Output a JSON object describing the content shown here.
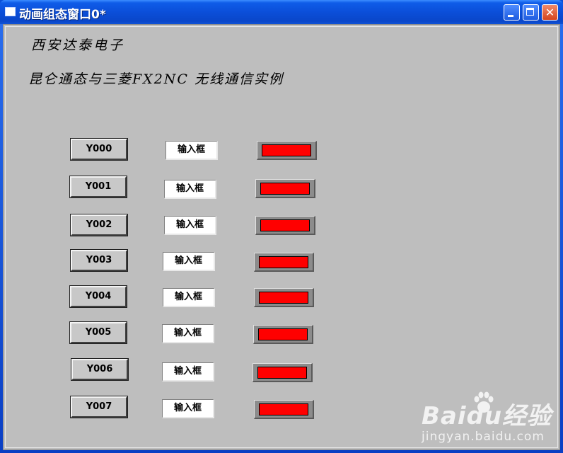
{
  "window": {
    "title": "动画组态窗口0*"
  },
  "labels": {
    "company": "西安达泰电子",
    "description": "昆仑通态与三菱FX2NC 无线通信实例"
  },
  "rows": [
    {
      "button": "Y000",
      "input": "输入框",
      "lamp_color": "#ff0000"
    },
    {
      "button": "Y001",
      "input": "输入框",
      "lamp_color": "#ff0000"
    },
    {
      "button": "Y002",
      "input": "输入框",
      "lamp_color": "#ff0000"
    },
    {
      "button": "Y003",
      "input": "输入框",
      "lamp_color": "#ff0000"
    },
    {
      "button": "Y004",
      "input": "输入框",
      "lamp_color": "#ff0000"
    },
    {
      "button": "Y005",
      "input": "输入框",
      "lamp_color": "#ff0000"
    },
    {
      "button": "Y006",
      "input": "输入框",
      "lamp_color": "#ff0000"
    },
    {
      "button": "Y007",
      "input": "输入框",
      "lamp_color": "#ff0000"
    }
  ],
  "watermark": {
    "logo": "Baidu经验",
    "url": "jingyan.baidu.com"
  },
  "colors": {
    "background": "#bebebe",
    "lamp_off": "#ff0000",
    "titlebar": "#0b4fd9"
  }
}
